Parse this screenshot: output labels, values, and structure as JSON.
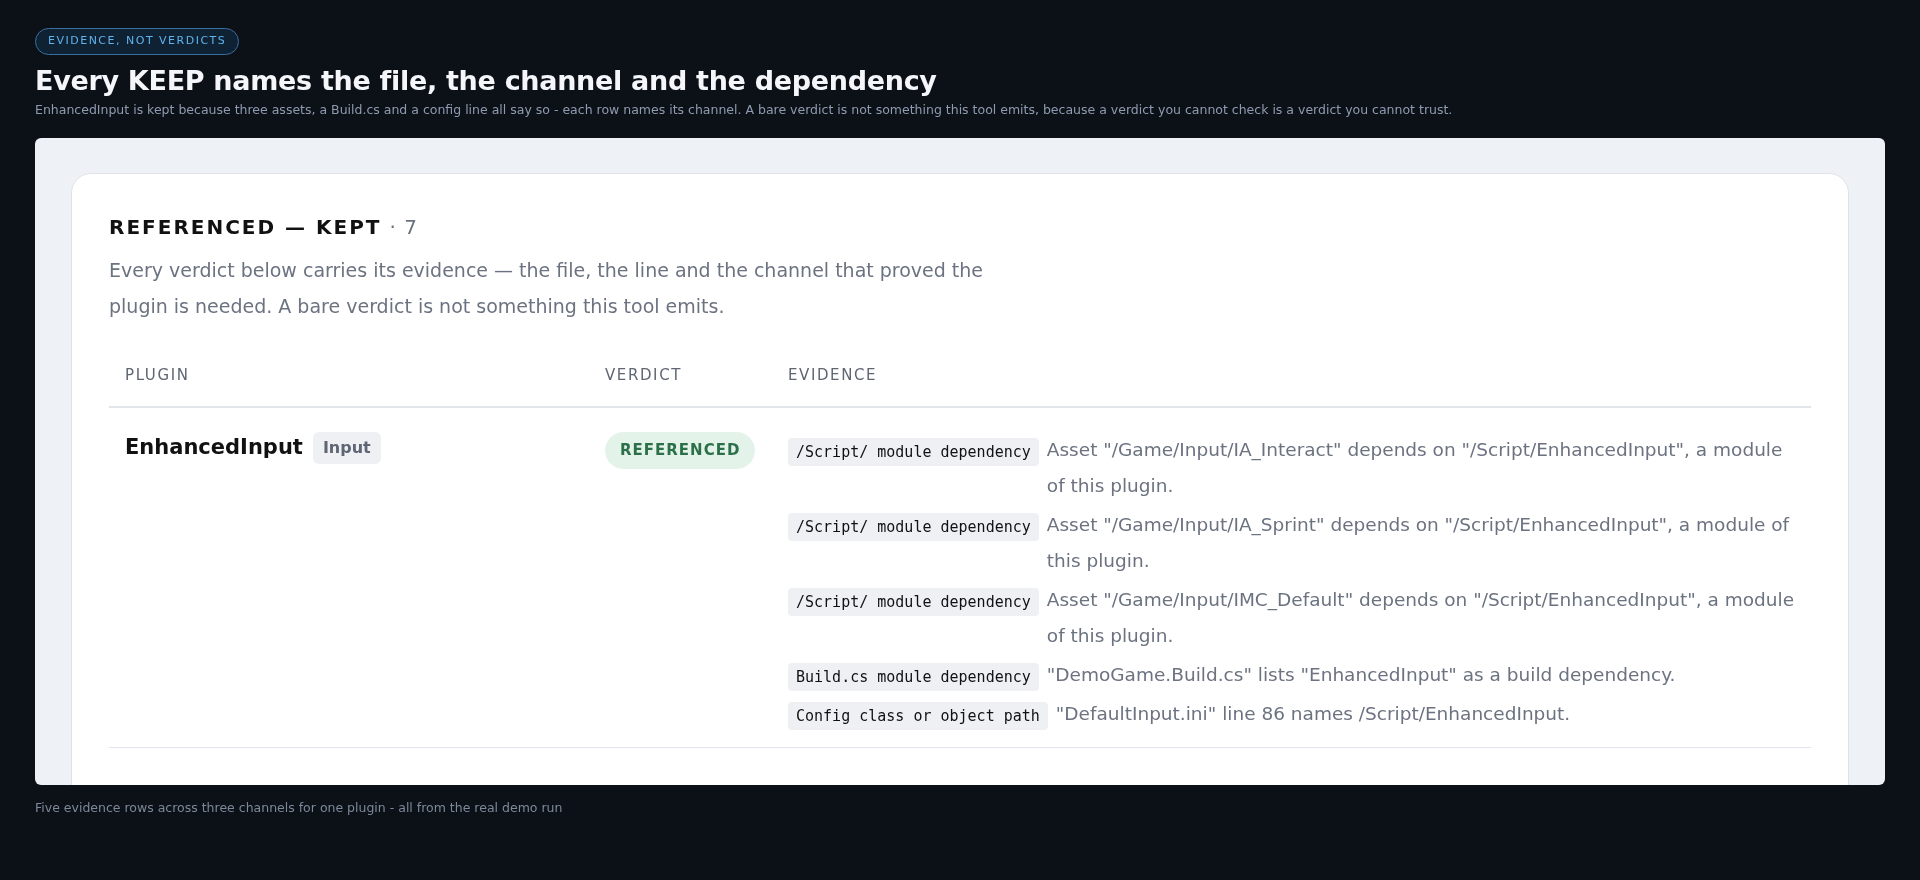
{
  "eyebrow": "EVIDENCE, NOT VERDICTS",
  "title": "Every KEEP names the file, the channel and the dependency",
  "subtitle": "EnhancedInput is kept because three assets, a Build.cs and a config line all say so - each row names its channel. A bare verdict is not something this tool emits, because a verdict you cannot check is a verdict you cannot trust.",
  "section": {
    "heading": "REFERENCED — KEPT",
    "count": "· 7",
    "description": "Every verdict below carries its evidence — the file, the line and the channel that proved the plugin is needed. A bare verdict is not something this tool emits."
  },
  "table": {
    "columns": [
      "PLUGIN",
      "VERDICT",
      "EVIDENCE"
    ],
    "rows": [
      {
        "plugin": "EnhancedInput",
        "tag": "Input",
        "verdict": "REFERENCED",
        "evidence": [
          {
            "channel": "/Script/ module dependency",
            "text": "Asset \"/Game/Input/IA_Interact\" depends on \"/Script/EnhancedInput\", a module of this plugin."
          },
          {
            "channel": "/Script/ module dependency",
            "text": "Asset \"/Game/Input/IA_Sprint\" depends on \"/Script/EnhancedInput\", a module of this plugin."
          },
          {
            "channel": "/Script/ module dependency",
            "text": "Asset \"/Game/Input/IMC_Default\" depends on \"/Script/EnhancedInput\", a module of this plugin."
          },
          {
            "channel": "Build.cs module dependency",
            "text": "\"DemoGame.Build.cs\" lists \"EnhancedInput\" as a build dependency."
          },
          {
            "channel": "Config class or object path",
            "text": "\"DefaultInput.ini\" line 86 names /Script/EnhancedInput."
          }
        ]
      }
    ]
  },
  "caption": "Five evidence rows across three channels for one plugin - all from the real demo run"
}
